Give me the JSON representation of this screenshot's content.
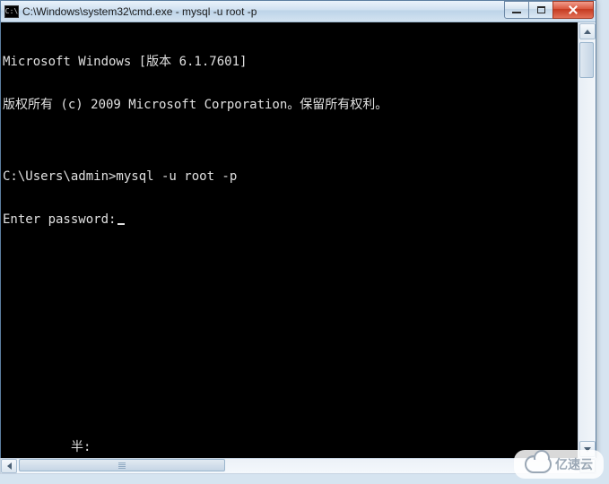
{
  "window": {
    "title": "C:\\Windows\\system32\\cmd.exe - mysql  -u root -p",
    "icon_text": "C:\\"
  },
  "terminal": {
    "lines": [
      "Microsoft Windows [版本 6.1.7601]",
      "版权所有 (c) 2009 Microsoft Corporation。保留所有权利。",
      "",
      "C:\\Users\\admin>mysql -u root -p",
      "Enter password:"
    ],
    "bottom_fragment": "半:"
  },
  "background_items": [],
  "watermark": {
    "text": "亿速云"
  }
}
